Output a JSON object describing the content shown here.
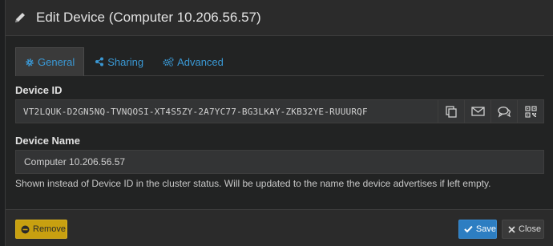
{
  "header": {
    "title": "Edit Device (Computer 10.206.56.57)",
    "icon": "pencil-icon"
  },
  "tabs": [
    {
      "label": "General",
      "icon": "gear-icon",
      "active": true
    },
    {
      "label": "Sharing",
      "icon": "share-icon",
      "active": false
    },
    {
      "label": "Advanced",
      "icon": "gears-icon",
      "active": false
    }
  ],
  "device_id": {
    "label": "Device ID",
    "value": "VT2LQUK-D2GN5NQ-TVNQOSI-XT4S5ZY-2A7YC77-BG3LKAY-ZKB32YE-RUUURQF",
    "buttons": [
      "copy-icon",
      "email-icon",
      "chat-icon",
      "qr-code-icon"
    ]
  },
  "device_name": {
    "label": "Device Name",
    "value": "Computer 10.206.56.57",
    "help": "Shown instead of Device ID in the cluster status. Will be updated to the name the device advertises if left empty."
  },
  "footer": {
    "remove_label": "Remove",
    "save_label": "Save",
    "close_label": "Close"
  },
  "colors": {
    "accent": "#3a98d4",
    "save": "#2d7ec2",
    "remove": "#c8a010",
    "background": "#222323"
  }
}
